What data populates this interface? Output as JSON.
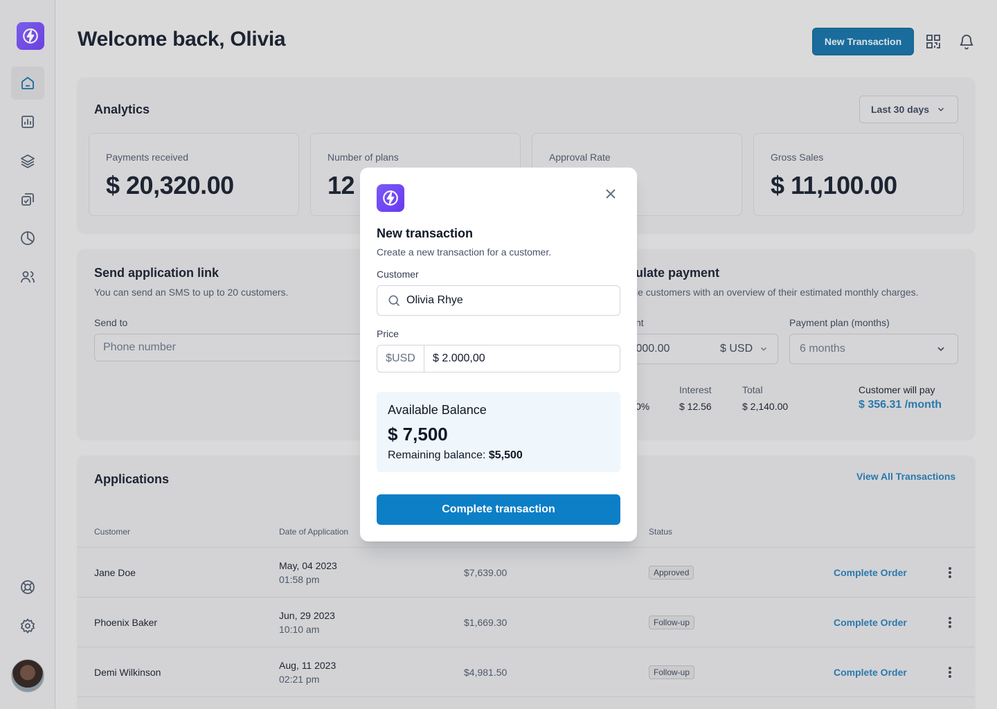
{
  "header": {
    "title": "Welcome back, Olivia",
    "new_transaction_label": "New Transaction"
  },
  "sidebar": {
    "items": [
      {
        "icon": "home-icon"
      },
      {
        "icon": "bar-chart-icon"
      },
      {
        "icon": "layers-icon"
      },
      {
        "icon": "check-square-icon"
      },
      {
        "icon": "pie-chart-icon"
      },
      {
        "icon": "users-icon"
      }
    ],
    "footer": [
      {
        "icon": "help-lifebuoy-icon"
      },
      {
        "icon": "settings-gear-icon"
      }
    ]
  },
  "analytics": {
    "title": "Analytics",
    "range": "Last 30 days",
    "stats": [
      {
        "label": "Payments received",
        "value": "$ 20,320.00"
      },
      {
        "label": "Number of plans",
        "value": "12"
      },
      {
        "label": "Approval Rate",
        "value": ""
      },
      {
        "label": "Gross Sales",
        "value": "$ 11,100.00"
      }
    ]
  },
  "send_link": {
    "title": "Send application link",
    "subtitle": "You can send an SMS to up to 20 customers.",
    "send_to_label": "Send to",
    "phone_placeholder": "Phone number"
  },
  "calculate": {
    "title_visible": "ulate payment",
    "subtitle_visible": "le customers with an overview of their estimated monthly charges.",
    "amount_label_visible": "nt",
    "amount_value_visible": ",000.00",
    "currency": "$ USD",
    "plan_label": "Payment plan (months)",
    "plan_value": "6 months",
    "rate_visible": "0%",
    "interest_label": "Interest",
    "interest_value": "$ 12.56",
    "total_label": "Total",
    "total_value": "$ 2,140.00",
    "pay_label": "Customer will pay",
    "pay_value": "$ 356.31 /month"
  },
  "applications": {
    "title": "Applications",
    "view_all": "View All Transactions",
    "columns": [
      "Customer",
      "Date of Application",
      "Status"
    ],
    "rows": [
      {
        "customer": "Jane Doe",
        "date": "May, 04 2023",
        "time": "01:58 pm",
        "amount": "$7,639.00",
        "status": "Approved",
        "action": "Complete Order"
      },
      {
        "customer": "Phoenix Baker",
        "date": "Jun, 29 2023",
        "time": "10:10 am",
        "amount": "$1,669.30",
        "status": "Follow-up",
        "action": "Complete Order"
      },
      {
        "customer": "Demi Wilkinson",
        "date": "Aug, 11 2023",
        "time": "02:21 pm",
        "amount": "$4,981.50",
        "status": "Follow-up",
        "action": "Complete Order"
      }
    ]
  },
  "modal": {
    "title": "New transaction",
    "subtitle": "Create a new transaction for a customer.",
    "customer_label": "Customer",
    "customer_value": "Olivia Rhye",
    "price_label": "Price",
    "price_currency": "$USD",
    "price_value": "$ 2.000,00",
    "balance_label": "Available Balance",
    "balance_value": "$ 7,500",
    "remaining_label": "Remaining balance: ",
    "remaining_value": "$5,500",
    "submit_label": "Complete transaction"
  },
  "colors": {
    "primary": "#0c7fc7",
    "brand_purple": "#6938ef",
    "link": "#1f78b4"
  }
}
